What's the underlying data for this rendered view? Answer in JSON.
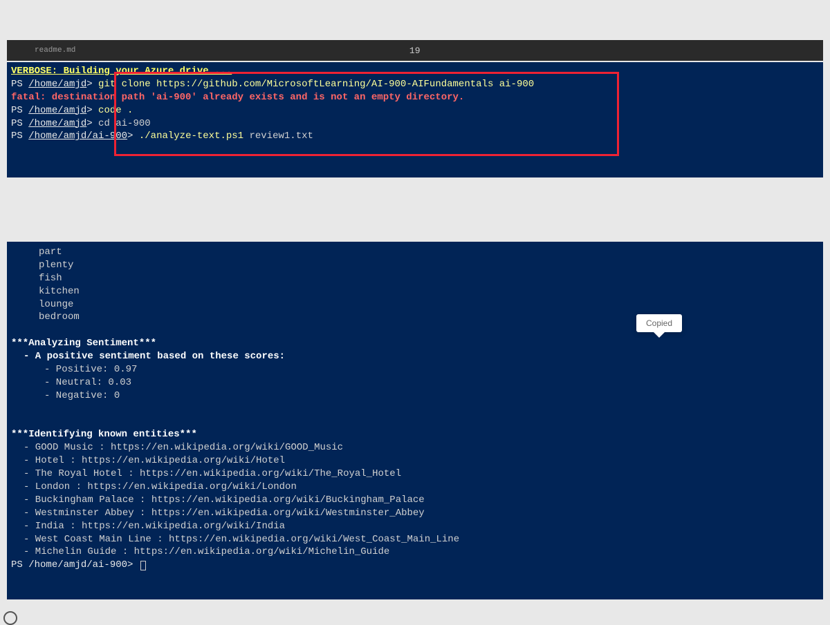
{
  "tab": {
    "filename": "readme.md",
    "number": "19"
  },
  "verbose": "VERBOSE: Building your Azure drive ...",
  "lines": {
    "l1": {
      "prompt": "PS ",
      "home": "/home/amjd",
      "gt": "> ",
      "cmd": "git clone https://github.com/MicrosoftLearning/AI-900-AIFundamentals ai-900"
    },
    "l2": "fatal: destination path 'ai-900' already exists and is not an empty directory.",
    "l3": {
      "prompt": "PS ",
      "home": "/home/amjd",
      "gt": "> ",
      "cmd": "code ."
    },
    "l4": {
      "prompt": "PS ",
      "home": "/home/amjd",
      "gt": ">  ",
      "cmd": "cd ai-900"
    },
    "l5": {
      "prompt": "PS ",
      "home": "/home/amjd/ai-900",
      "gt": ">  ",
      "cmd": "./analyze-text.ps1",
      "arg": " review1.txt"
    }
  },
  "words": [
    "part",
    "plenty",
    "fish",
    "kitchen",
    "lounge",
    "bedroom"
  ],
  "sentiment": {
    "header": "***Analyzing Sentiment***",
    "summary": " - A positive sentiment based on these scores:",
    "scores": [
      "   - Positive: 0.97",
      "   - Neutral: 0.03",
      "   - Negative: 0"
    ]
  },
  "entities": {
    "header": "***Identifying known entities***",
    "items": [
      " - GOOD Music : https://en.wikipedia.org/wiki/GOOD_Music",
      " - Hotel : https://en.wikipedia.org/wiki/Hotel",
      " - The Royal Hotel : https://en.wikipedia.org/wiki/The_Royal_Hotel",
      " - London : https://en.wikipedia.org/wiki/London",
      " - Buckingham Palace : https://en.wikipedia.org/wiki/Buckingham_Palace",
      " - Westminster Abbey : https://en.wikipedia.org/wiki/Westminster_Abbey",
      " - India : https://en.wikipedia.org/wiki/India",
      " - West Coast Main Line : https://en.wikipedia.org/wiki/West_Coast_Main_Line",
      " - Michelin Guide : https://en.wikipedia.org/wiki/Michelin_Guide"
    ]
  },
  "final_prompt": {
    "prompt": "PS ",
    "path": "/home/amjd/ai-900",
    "gt": "> "
  },
  "tooltip": "Copied"
}
